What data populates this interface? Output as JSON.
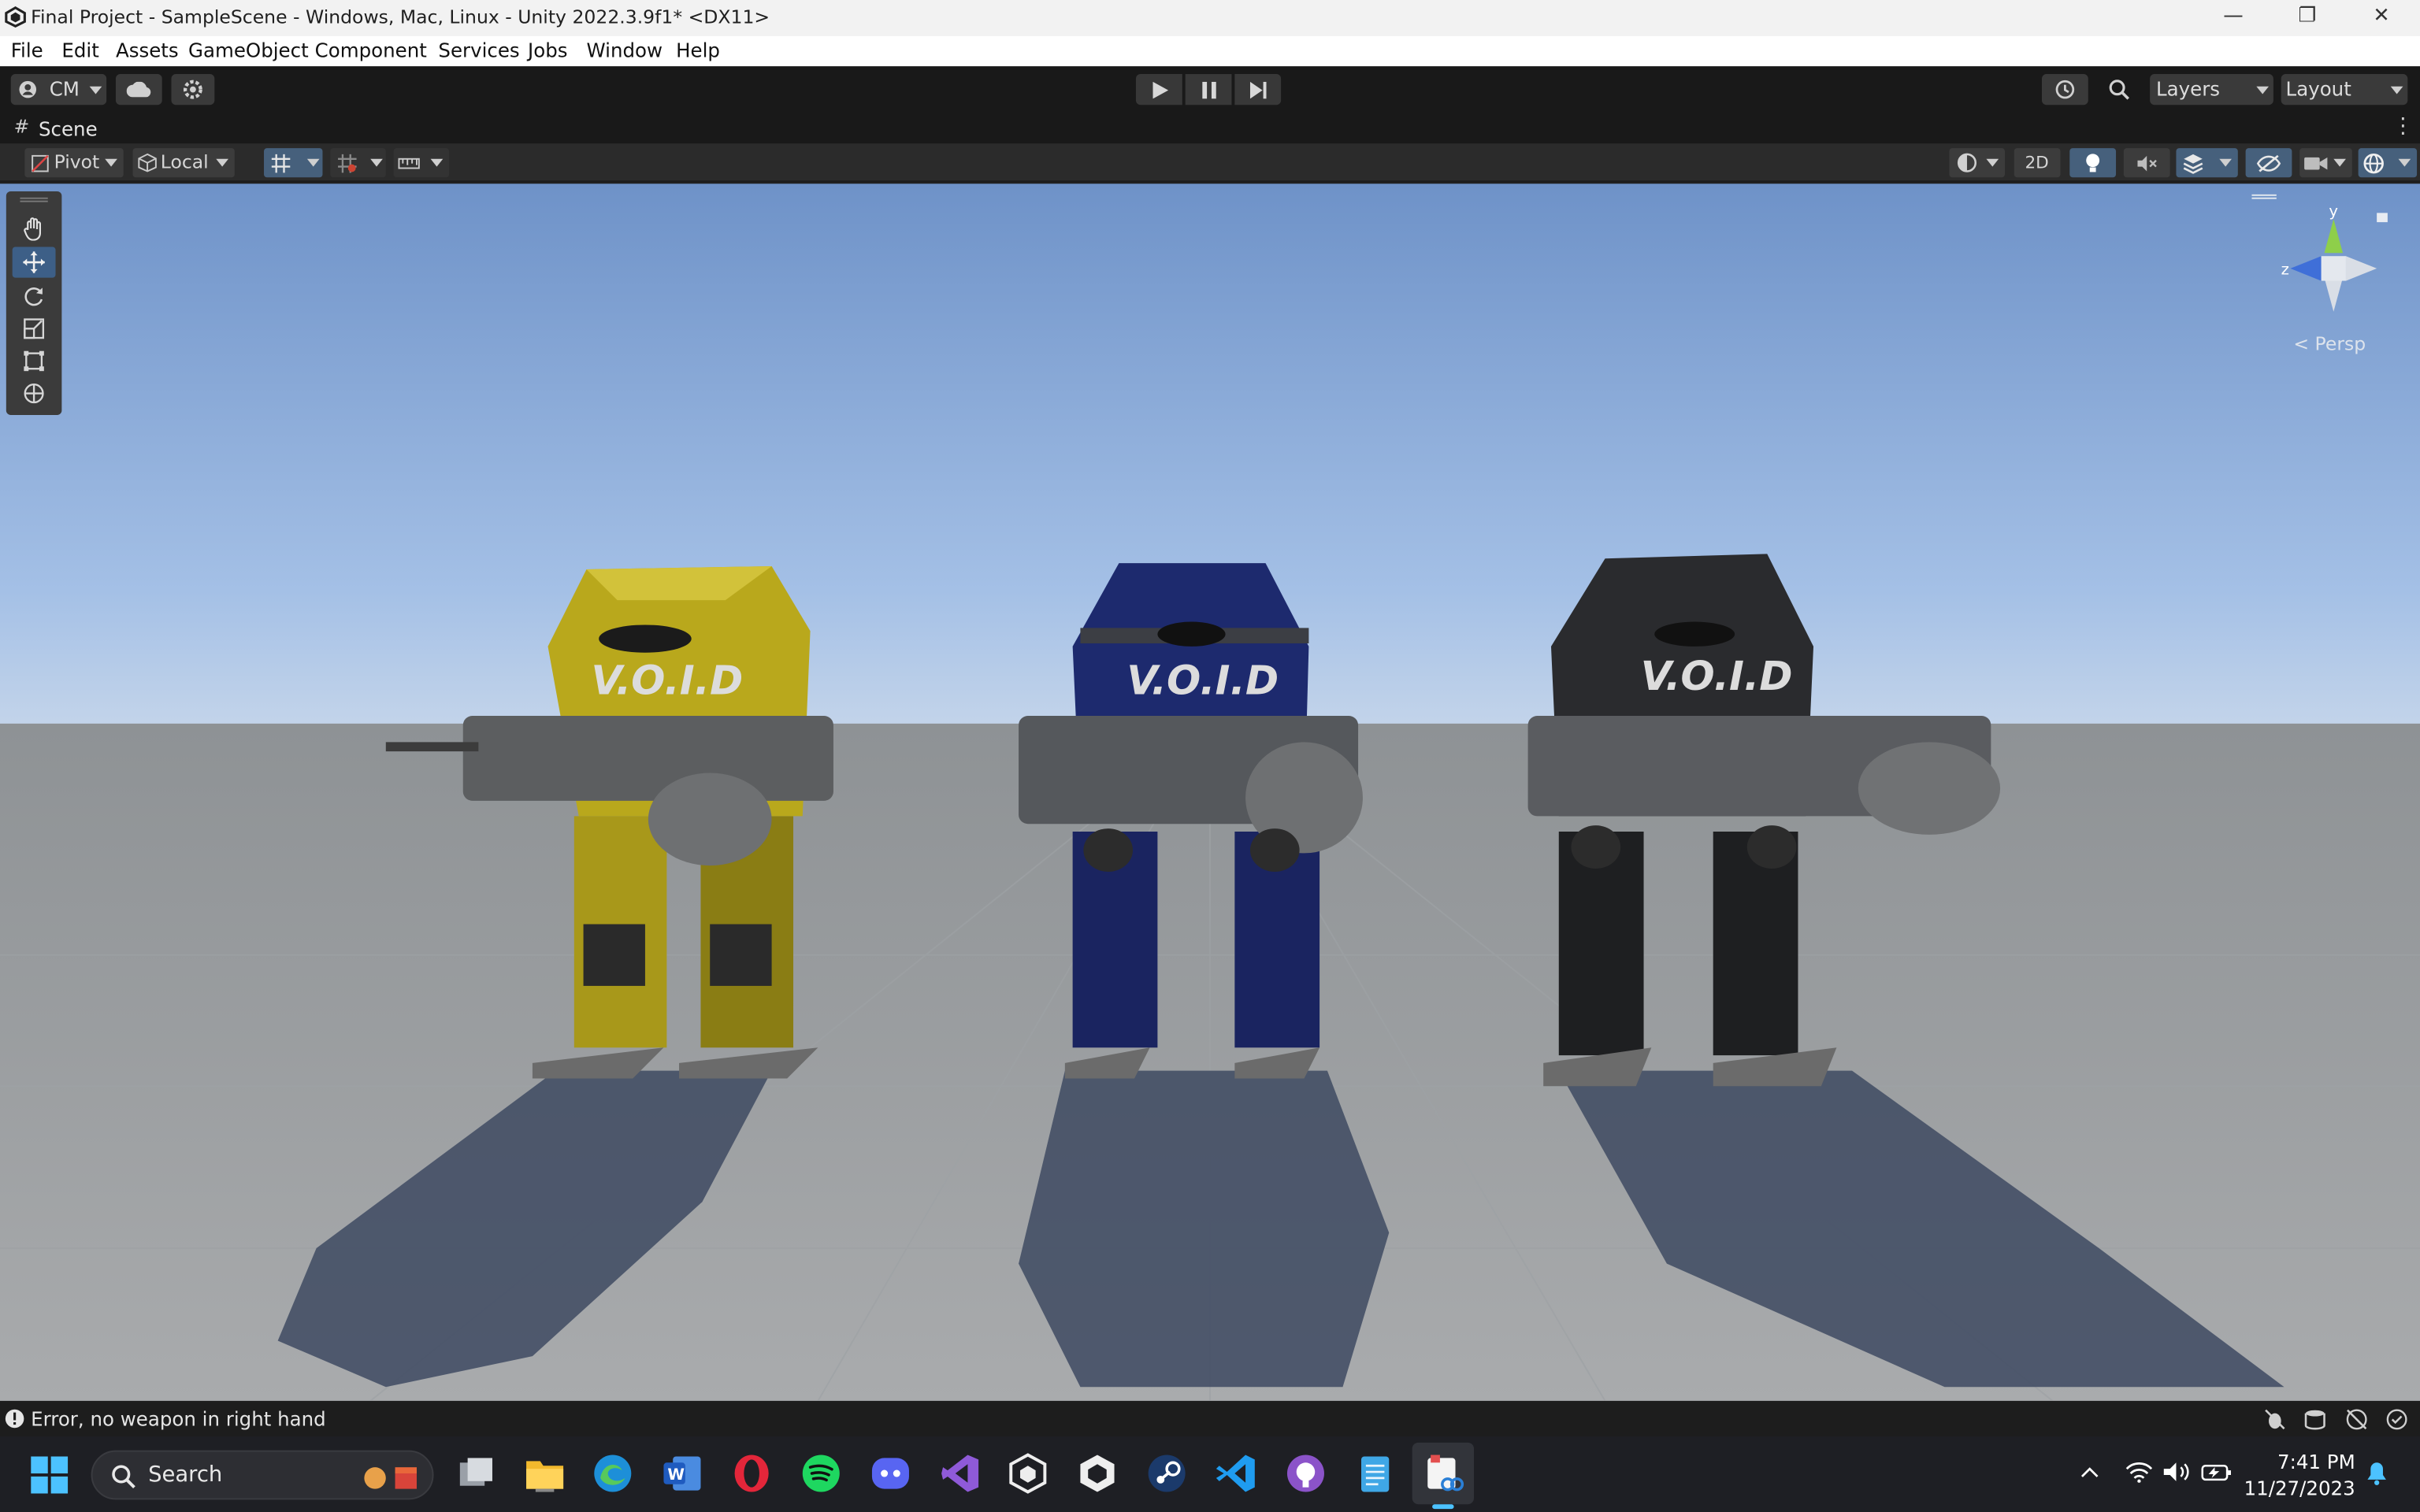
{
  "window": {
    "title": "Final Project - SampleScene - Windows, Mac, Linux - Unity 2022.3.9f1* <DX11>",
    "minimize_glyph": "—",
    "restore_glyph": "❐",
    "close_glyph": "✕"
  },
  "menu": [
    "File",
    "Edit",
    "Assets",
    "GameObject",
    "Component",
    "Services",
    "Jobs",
    "Window",
    "Help"
  ],
  "toolbar": {
    "account_label": "CM",
    "layers_label": "Layers",
    "layout_label": "Layout"
  },
  "scene_tab": {
    "label": "Scene",
    "pivot_label": "Pivot",
    "local_label": "Local",
    "mode_2d_label": "2D"
  },
  "viewport": {
    "gizmo_y": "y",
    "gizmo_z": "z",
    "projection_label": "Persp",
    "robots": [
      {
        "id": "yellow",
        "color": "#b9a81c",
        "label": "V.O.I.D"
      },
      {
        "id": "blue",
        "color": "#1d2a6e",
        "label": "V.O.I.D"
      },
      {
        "id": "black",
        "color": "#2a2b2e",
        "label": "V.O.I.D"
      }
    ]
  },
  "status": {
    "message": "Error, no weapon in right hand"
  },
  "taskbar": {
    "search_placeholder": "Search",
    "time": "7:41 PM",
    "date": "11/27/2023",
    "apps": [
      "task-view",
      "file-explorer",
      "edge",
      "word",
      "opera",
      "spotify",
      "discord",
      "visual-studio",
      "unity",
      "unity-hub",
      "steam",
      "vscode",
      "github-desktop",
      "notepad",
      "snipping-tool"
    ]
  },
  "colors": {
    "editor_bg": "#191919",
    "accent_blue": "#3d5f87",
    "sky_top": "#6e92c8",
    "ground": "#8f9396"
  }
}
